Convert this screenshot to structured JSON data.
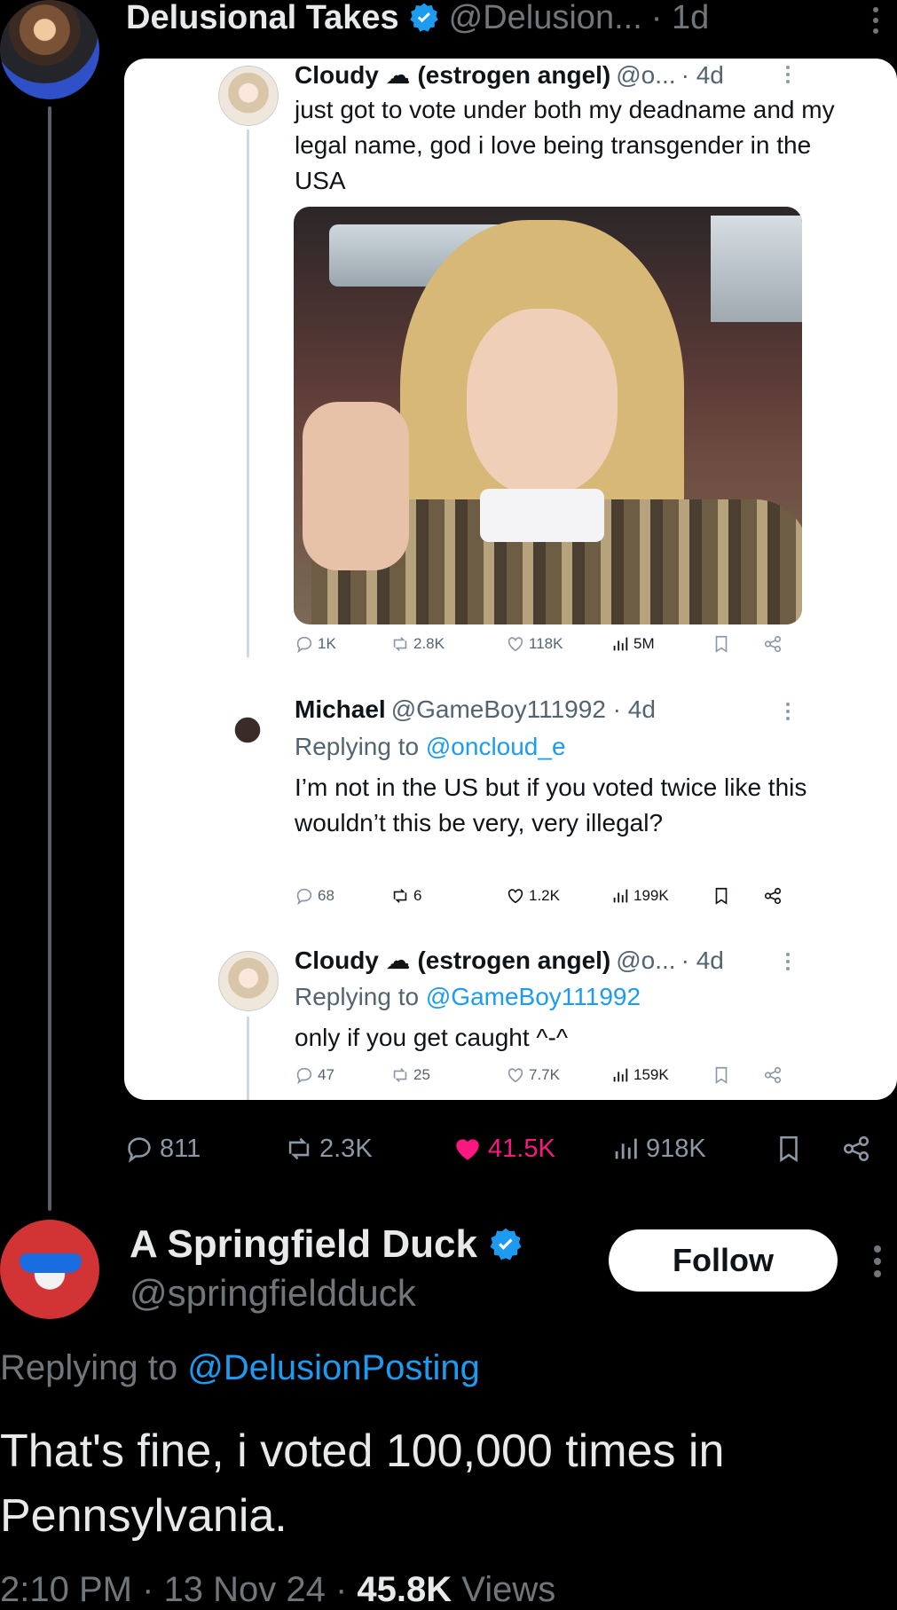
{
  "outer_tweet": {
    "name": "Delusional Takes",
    "handle": "@Delusion...",
    "time": "· 1d",
    "actions": {
      "replies": "811",
      "retweets": "2.3K",
      "likes": "41.5K",
      "views": "918K"
    }
  },
  "quoted": {
    "tweet1": {
      "name": "Cloudy ☁ (estrogen angel)",
      "handle": "@o...",
      "time": "· 4d",
      "text": "just got to vote under both my deadname and my legal name, god i love being transgender in the USA",
      "actions": {
        "replies": "1K",
        "retweets": "2.8K",
        "likes": "118K",
        "views": "5M"
      }
    },
    "tweet2": {
      "name": "Michael",
      "handle": "@GameBoy111992 · 4d",
      "replying_prefix": "Replying to",
      "replying_to": "@oncloud_e",
      "text": "I’m not in the US but if you voted twice like this wouldn’t this be very, very illegal?",
      "actions": {
        "replies": "68",
        "retweets": "6",
        "likes": "1.2K",
        "views": "199K"
      }
    },
    "tweet3": {
      "name": "Cloudy ☁ (estrogen angel)",
      "handle": "@o...",
      "time": "· 4d",
      "replying_prefix": "Replying to",
      "replying_to": "@GameBoy111992",
      "text": "only if you get caught ^-^",
      "actions": {
        "replies": "47",
        "retweets": "25",
        "likes": "7.7K",
        "views": "159K"
      }
    }
  },
  "reply": {
    "name": "A Springfield Duck",
    "handle": "@springfieldduck",
    "follow_label": "Follow",
    "replying_prefix": "Replying to",
    "replying_to": "@DelusionPosting",
    "text": "That's fine, i voted 100,000 times in Pennsylvania.",
    "time": "2:10 PM · 13 Nov 24 ·",
    "views_count": "45.8K",
    "views_label": "Views"
  },
  "colors": {
    "background": "#000000",
    "verified": "#1d9bf0",
    "link": "#1d9bf0",
    "like": "#f91880",
    "muted": "#71767b"
  },
  "icons": [
    "verified-badge-icon",
    "reply-icon",
    "retweet-icon",
    "like-icon",
    "views-icon",
    "bookmark-icon",
    "share-icon",
    "more-icon"
  ]
}
